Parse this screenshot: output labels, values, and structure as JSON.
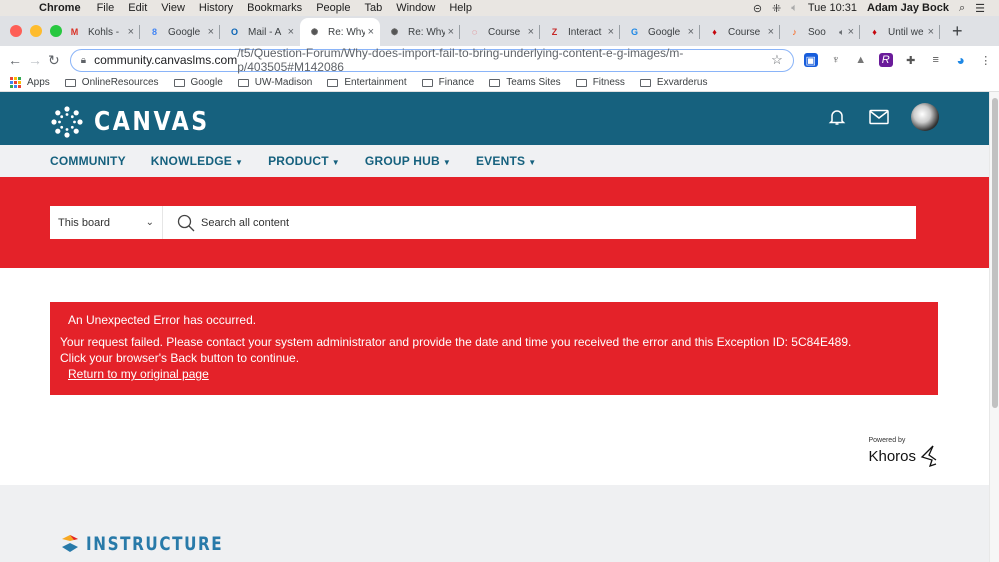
{
  "menubar": {
    "app": "Chrome",
    "items": [
      "File",
      "Edit",
      "View",
      "History",
      "Bookmarks",
      "People",
      "Tab",
      "Window",
      "Help"
    ],
    "clock": "Tue 10:31",
    "user": "Adam Jay Bock"
  },
  "tabs": [
    {
      "label": "Kohls - ",
      "icon": "gmail-icon",
      "color": "#d93025",
      "glyph": "M"
    },
    {
      "label": "Google ",
      "icon": "google-calendar-icon",
      "color": "#4285f4",
      "glyph": "8"
    },
    {
      "label": "Mail - A",
      "icon": "outlook-icon",
      "color": "#0a64b5",
      "glyph": "O"
    },
    {
      "label": "Re: Why",
      "icon": "canvas-icon",
      "color": "#555555",
      "glyph": "✺",
      "active": true
    },
    {
      "label": "Re: Why",
      "icon": "canvas-icon",
      "color": "#555555",
      "glyph": "✺"
    },
    {
      "label": "Course ",
      "icon": "canvas-red-icon",
      "color": "#e42229",
      "glyph": "◌"
    },
    {
      "label": "Interact",
      "icon": "interact-icon",
      "color": "#c62828",
      "glyph": "Z"
    },
    {
      "label": "Google ",
      "icon": "google-classroom-icon",
      "color": "#1e88e5",
      "glyph": "G"
    },
    {
      "label": "Course ",
      "icon": "uw-crest-icon",
      "color": "#c5050c",
      "glyph": "♦"
    },
    {
      "label": "Soo",
      "icon": "soundcloud-icon",
      "color": "#ff5500",
      "glyph": "♪",
      "audio": true
    },
    {
      "label": "Until we",
      "icon": "uw-crest-icon",
      "color": "#c5050c",
      "glyph": "♦"
    }
  ],
  "address": {
    "host": "community.canvaslms.com",
    "path": "/t5/Question-Forum/Why-does-import-fail-to-bring-underlying-content-e-g-images/m-p/403505#M142086"
  },
  "bookmarks": [
    {
      "label": "Apps",
      "type": "apps"
    },
    {
      "label": "OnlineResources",
      "type": "folder"
    },
    {
      "label": "Google",
      "type": "folder"
    },
    {
      "label": "UW-Madison",
      "type": "folder"
    },
    {
      "label": "Entertainment",
      "type": "folder"
    },
    {
      "label": "Finance",
      "type": "folder"
    },
    {
      "label": "Teams Sites",
      "type": "folder"
    },
    {
      "label": "Fitness",
      "type": "folder"
    },
    {
      "label": "Exvarderus",
      "type": "folder"
    }
  ],
  "site": {
    "brand": "CANVAS",
    "nav": [
      {
        "label": "COMMUNITY",
        "dropdown": false
      },
      {
        "label": "KNOWLEDGE",
        "dropdown": true
      },
      {
        "label": "PRODUCT",
        "dropdown": true
      },
      {
        "label": "GROUP HUB",
        "dropdown": true
      },
      {
        "label": "EVENTS",
        "dropdown": true
      }
    ],
    "search": {
      "scope": "This board",
      "placeholder": "Search all content"
    },
    "error": {
      "title": "An Unexpected Error has occurred.",
      "line1": "Your request failed. Please contact your system administrator and provide the date and time you received the error and this Exception ID: 5C84E489.",
      "line2": "Click your browser's Back button to continue.",
      "link": "Return to my original page"
    },
    "powered_by": "Powered by",
    "khoros": "Khoros",
    "footer_brand": "INSTRUCTURE"
  },
  "colors": {
    "header": "#16617e",
    "accent_red": "#e42229",
    "nav_bg": "#f0f1f3"
  }
}
